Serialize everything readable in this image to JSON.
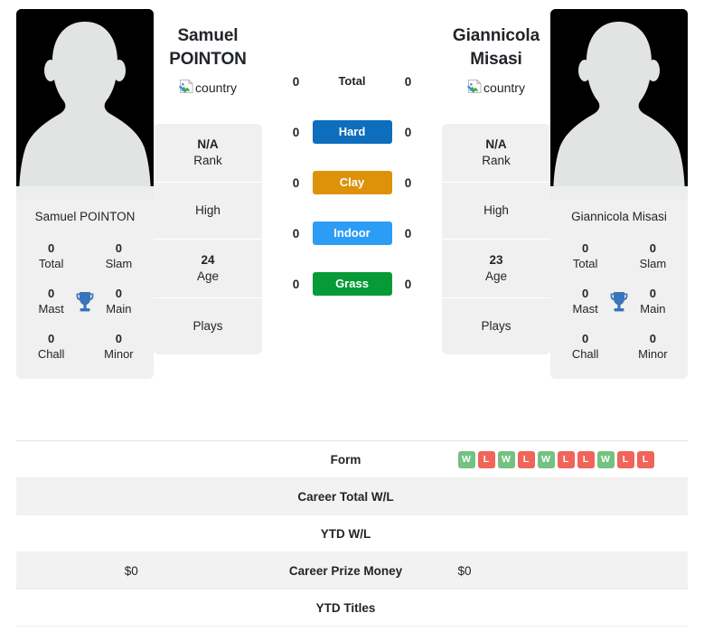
{
  "players": {
    "left": {
      "first_name": "Samuel",
      "last_name": "POINTON",
      "full_name": "Samuel POINTON",
      "country_alt": "country",
      "rank_value": "N/A",
      "rank_label": "Rank",
      "high_value": "",
      "high_label": "High",
      "age_value": "24",
      "age_label": "Age",
      "plays_value": "",
      "plays_label": "Plays",
      "titles": {
        "total_value": "0",
        "total_label": "Total",
        "slam_value": "0",
        "slam_label": "Slam",
        "mast_value": "0",
        "mast_label": "Mast",
        "main_value": "0",
        "main_label": "Main",
        "chall_value": "0",
        "chall_label": "Chall",
        "minor_value": "0",
        "minor_label": "Minor"
      }
    },
    "right": {
      "first_name": "Giannicola",
      "last_name": "Misasi",
      "full_name": "Giannicola Misasi",
      "country_alt": "country",
      "rank_value": "N/A",
      "rank_label": "Rank",
      "high_value": "",
      "high_label": "High",
      "age_value": "23",
      "age_label": "Age",
      "plays_value": "",
      "plays_label": "Plays",
      "titles": {
        "total_value": "0",
        "total_label": "Total",
        "slam_value": "0",
        "slam_label": "Slam",
        "mast_value": "0",
        "mast_label": "Mast",
        "main_value": "0",
        "main_label": "Main",
        "chall_value": "0",
        "chall_label": "Chall",
        "minor_value": "0",
        "minor_label": "Minor"
      }
    }
  },
  "head_to_head": [
    {
      "label": "Total",
      "left": "0",
      "right": "0",
      "color": "none",
      "plain": true
    },
    {
      "label": "Hard",
      "left": "0",
      "right": "0",
      "color": "#0d6ebd",
      "plain": false
    },
    {
      "label": "Clay",
      "left": "0",
      "right": "0",
      "color": "#dd9209",
      "plain": false
    },
    {
      "label": "Indoor",
      "left": "0",
      "right": "0",
      "color": "#2c9df4",
      "plain": false
    },
    {
      "label": "Grass",
      "left": "0",
      "right": "0",
      "color": "#079b38",
      "plain": false
    }
  ],
  "stats_table": [
    {
      "label": "Form",
      "left": "",
      "right": "",
      "striped": false,
      "type": "form"
    },
    {
      "label": "Career Total W/L",
      "left": "",
      "right": "",
      "striped": true,
      "type": "text"
    },
    {
      "label": "YTD W/L",
      "left": "",
      "right": "",
      "striped": false,
      "type": "text"
    },
    {
      "label": "Career Prize Money",
      "left": "$0",
      "right": "$0",
      "striped": true,
      "type": "text"
    },
    {
      "label": "YTD Titles",
      "left": "",
      "right": "",
      "striped": false,
      "type": "text"
    }
  ],
  "form": {
    "left": [],
    "right": [
      "W",
      "L",
      "W",
      "L",
      "W",
      "L",
      "L",
      "W",
      "L",
      "L"
    ]
  },
  "colors": {
    "win": "#73c281",
    "loss": "#f0645a",
    "trophy": "#3b74b8",
    "card_bg": "#f0f0f0",
    "stripe_bg": "#f2f2f2"
  }
}
